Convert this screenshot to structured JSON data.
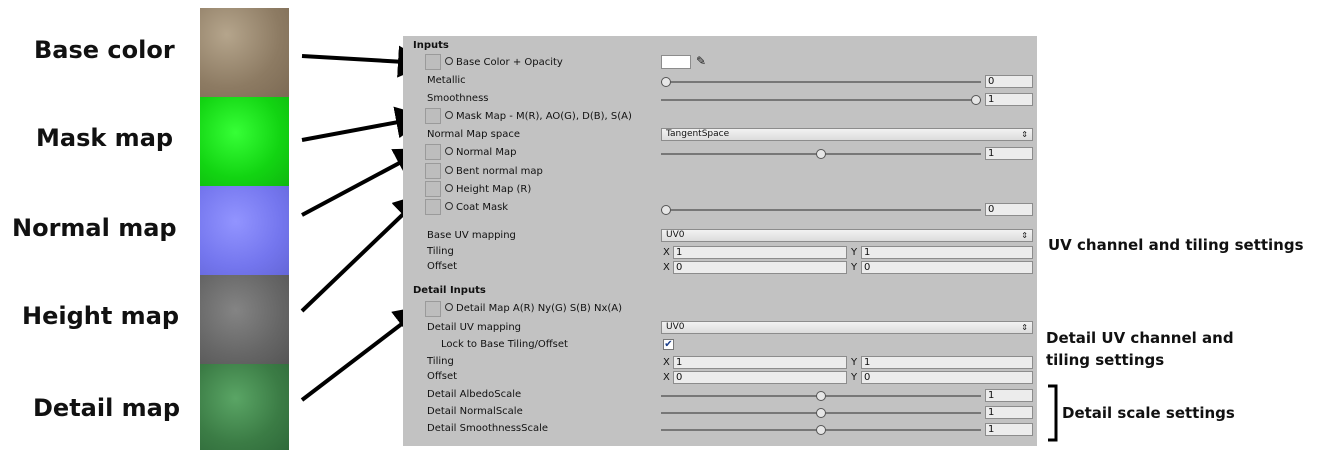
{
  "labels": {
    "base": "Base color",
    "mask": "Mask map",
    "normal": "Normal map",
    "height": "Height map",
    "detail": "Detail map"
  },
  "annotations": {
    "uv": "UV channel and tiling settings",
    "detail_uv_1": "Detail UV channel and",
    "detail_uv_2": "tiling settings",
    "detail_scale": "Detail scale settings"
  },
  "colors": {
    "base": "#9c8a72",
    "mask": "#1ee61e",
    "normal": "#7a7cf0",
    "height": "#6a6a6a",
    "detail": "#3f8a4a",
    "panel": "#c2c2c2"
  },
  "inputs": {
    "title": "Inputs",
    "base_color": "Base Color + Opacity",
    "metallic": "Metallic",
    "metallic_val": "0",
    "metallic_level": 0,
    "smoothness": "Smoothness",
    "smoothness_val": "1",
    "smoothness_level": 1,
    "mask": "Mask Map - M(R), AO(G), D(B), S(A)",
    "normal_space": "Normal Map space",
    "normal_space_val": "TangentSpace",
    "normal": "Normal Map",
    "normal_val": "1",
    "normal_level": 0.5,
    "bent": "Bent normal map",
    "height": "Height Map (R)",
    "coat": "Coat Mask",
    "coat_val": "0",
    "coat_level": 0,
    "base_uv": "Base UV mapping",
    "base_uv_val": "UV0",
    "tiling": "Tiling",
    "tiling_x": "1",
    "tiling_y": "1",
    "offset": "Offset",
    "offset_x": "0",
    "offset_y": "0",
    "x": "X",
    "y": "Y"
  },
  "detail": {
    "title": "Detail Inputs",
    "map": "Detail Map A(R) Ny(G) S(B) Nx(A)",
    "uv": "Detail UV mapping",
    "uv_val": "UV0",
    "lock": "Lock to Base Tiling/Offset",
    "tiling": "Tiling",
    "tiling_x": "1",
    "tiling_y": "1",
    "offset": "Offset",
    "offset_x": "0",
    "offset_y": "0",
    "albedo": "Detail AlbedoScale",
    "albedo_val": "1",
    "albedo_level": 0.5,
    "normal": "Detail NormalScale",
    "normal_val": "1",
    "normal_level": 0.5,
    "smooth": "Detail SmoothnessScale",
    "smooth_val": "1",
    "smooth_level": 0.5
  }
}
